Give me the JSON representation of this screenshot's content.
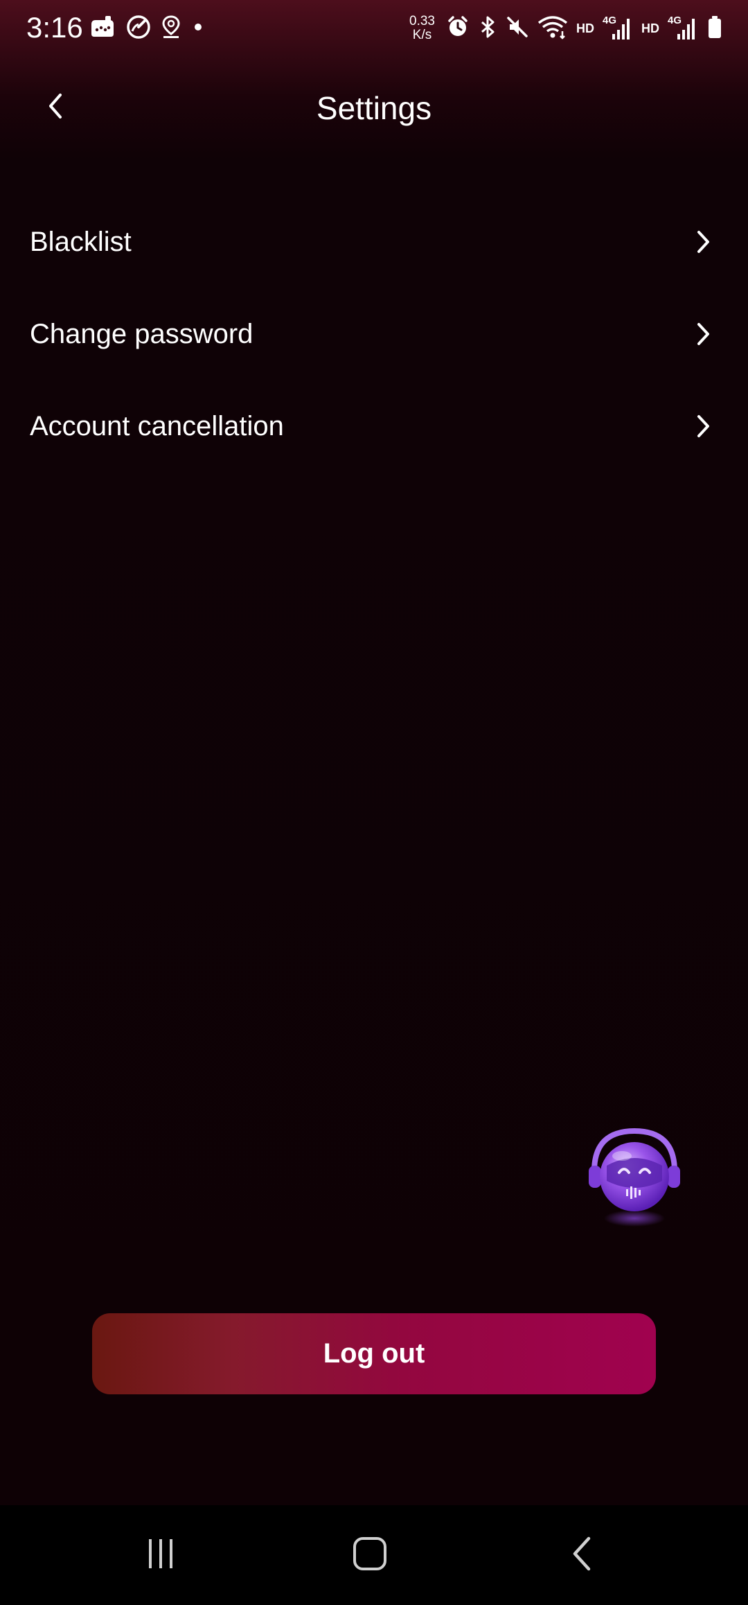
{
  "status_bar": {
    "time": "3:16",
    "net_speed_value": "0.33",
    "net_speed_unit": "K/s",
    "hd_label_1": "HD",
    "hd_label_2": "HD",
    "lte_label_1": "4G",
    "lte_label_2": "4G",
    "left_icons": [
      "notification-app-icon",
      "speed-gauge-icon",
      "location-pin-icon",
      "dot-icon"
    ],
    "right_icons": [
      "alarm-icon",
      "bluetooth-icon",
      "mute-icon",
      "wifi-icon",
      "signal-icon",
      "signal-icon",
      "battery-icon"
    ]
  },
  "header": {
    "title": "Settings",
    "back_icon": "chevron-left-icon"
  },
  "menu": {
    "items": [
      {
        "label": "Blacklist",
        "icon": "chevron-right-icon"
      },
      {
        "label": "Change password",
        "icon": "chevron-right-icon"
      },
      {
        "label": "Account cancellation",
        "icon": "chevron-right-icon"
      }
    ]
  },
  "assistant": {
    "icon": "robot-assistant-icon"
  },
  "logout": {
    "label": "Log out"
  },
  "nav_bar": {
    "recents_icon": "recents-icon",
    "home_icon": "home-icon",
    "back_icon": "back-nav-icon"
  },
  "colors": {
    "background": "#0e0105",
    "header_gradient_top": "#4d0e1c",
    "logout_gradient_start": "#6a1811",
    "logout_gradient_end": "#a0024f",
    "assistant_purple": "#8b46e0"
  }
}
